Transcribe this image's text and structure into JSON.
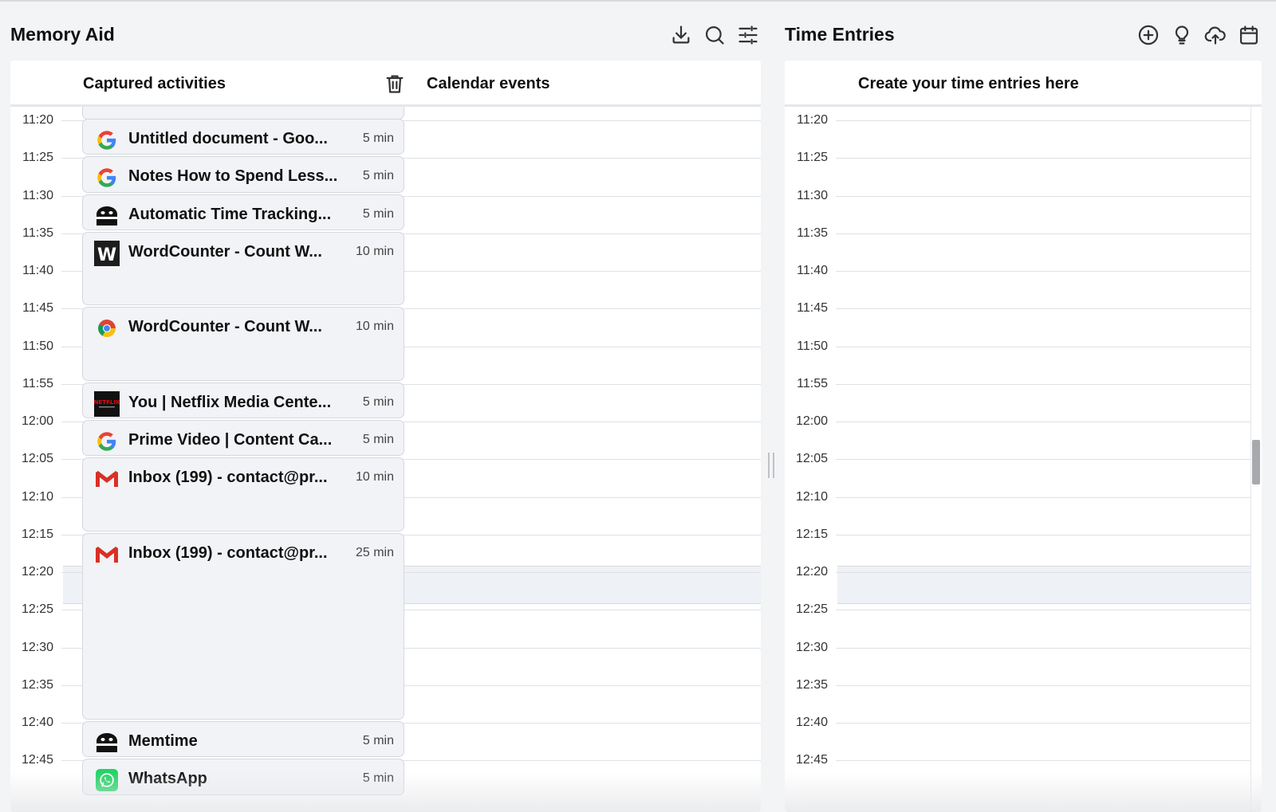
{
  "memory_aid": {
    "title": "Memory Aid",
    "toolbar": [
      "download-icon",
      "search-icon",
      "sliders-icon"
    ],
    "captured_activities_label": "Captured activities",
    "calendar_events_label": "Calendar events",
    "time_labels": [
      "11:20",
      "11:25",
      "11:30",
      "11:35",
      "11:40",
      "11:45",
      "11:50",
      "11:55",
      "12:00",
      "12:05",
      "12:10",
      "12:15",
      "12:20",
      "12:25",
      "12:30",
      "12:35",
      "12:40",
      "12:45"
    ],
    "activities": [
      {
        "icon": "google-icon",
        "title": "Untitled document - Goo...",
        "duration": "5 min"
      },
      {
        "icon": "google-icon",
        "title": "Notes How to Spend Less...",
        "duration": "5 min"
      },
      {
        "icon": "memtime-icon",
        "title": "Automatic Time Tracking...",
        "duration": "5 min"
      },
      {
        "icon": "wordcounter-icon",
        "title": "WordCounter - Count W...",
        "duration": "10 min"
      },
      {
        "icon": "chrome-icon",
        "title": "WordCounter - Count W...",
        "duration": "10 min"
      },
      {
        "icon": "netflix-icon",
        "title": "You | Netflix Media Cente...",
        "duration": "5 min"
      },
      {
        "icon": "google-icon",
        "title": "Prime Video | Content Ca...",
        "duration": "5 min"
      },
      {
        "icon": "gmail-icon",
        "title": "Inbox (199) - contact@pr...",
        "duration": "10 min"
      },
      {
        "icon": "gmail-icon",
        "title": "Inbox (199) - contact@pr...",
        "duration": "25 min"
      },
      {
        "icon": "memtime-icon",
        "title": "Memtime",
        "duration": "5 min"
      },
      {
        "icon": "whatsapp-icon",
        "title": "WhatsApp",
        "duration": "5 min"
      }
    ]
  },
  "time_entries": {
    "title": "Time Entries",
    "toolbar": [
      "add-circle-icon",
      "lightbulb-icon",
      "cloud-upload-icon",
      "calendar-icon"
    ],
    "header_label": "Create your time entries here",
    "time_labels": [
      "11:20",
      "11:25",
      "11:30",
      "11:35",
      "11:40",
      "11:45",
      "11:50",
      "11:55",
      "12:00",
      "12:05",
      "12:10",
      "12:15",
      "12:20",
      "12:25",
      "12:30",
      "12:35",
      "12:40",
      "12:45"
    ]
  },
  "colors": {
    "background": "#f3f4f6",
    "card": "#ffffff",
    "activity_bg": "#f1f3f6",
    "highlight_band": "#eef1f5",
    "gmail_red": "#d93025",
    "whatsapp_green": "#25d366"
  }
}
